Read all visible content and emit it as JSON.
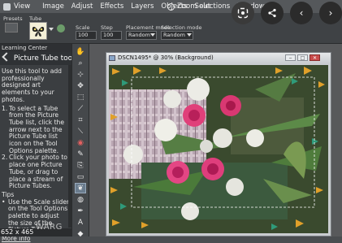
{
  "menu": {
    "items": [
      "View",
      "Image",
      "Adjust",
      "Effects",
      "Layers",
      "Objects",
      "Selections",
      "Window"
    ],
    "zoom_out_label": "Zoom out"
  },
  "options_bar": {
    "presets_label": "Presets",
    "tube_label": "Tube",
    "scale_label": "Scale",
    "scale_value": "100",
    "step_label": "Step",
    "step_value": "100",
    "placement_label": "Placement mode",
    "placement_value": "Random",
    "selection_label": "Selection mode",
    "selection_value": "Random",
    "extra_field_1": "",
    "extra_field_2": ""
  },
  "learning_center": {
    "panel_title": "Learning Center",
    "heading": "Picture Tube tool",
    "intro": "Use this tool to add professionally designed art elements to your photos.",
    "steps": [
      {
        "n": "1.",
        "text": "To select a Tube from the Picture Tube list, click the arrow next to the Picture Tube list icon on the Tool Options palette."
      },
      {
        "n": "2.",
        "text": "Click your photo to place one Picture Tube, or drag to place a stream of Picture Tubes."
      }
    ],
    "tips_label": "Tips",
    "tips": [
      "Use the Scale slider on the Tool Options palette to adjust the size of the Picture Tube."
    ],
    "more_link": "More info"
  },
  "status": {
    "coordinates": "652 x 465"
  },
  "document": {
    "title": "DSCN1495* @ 30% (Background)"
  },
  "watermark": "WARG",
  "colors": {
    "menubar": "#55585b",
    "panel": "#3b3e41",
    "workspace": "#58595b",
    "doc_title_bg": "#dfe2e5",
    "close_btn": "#c94c4c"
  }
}
